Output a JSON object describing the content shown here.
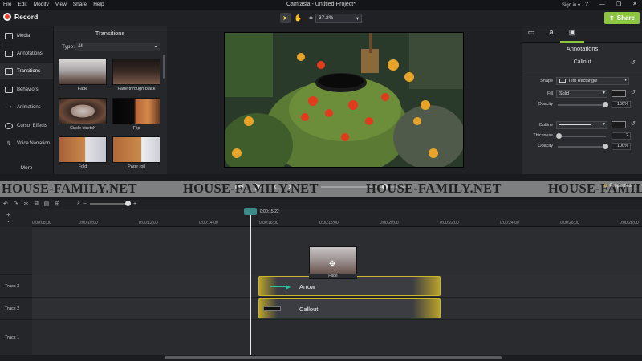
{
  "app": {
    "menu": [
      "File",
      "Edit",
      "Modify",
      "View",
      "Share",
      "Help"
    ],
    "title": "Camtasia - Untitled Project*",
    "sign_in": "Sign in ▾",
    "window_controls": [
      "?",
      "—",
      "❐",
      "✕"
    ]
  },
  "toolbar": {
    "record_label": "Record",
    "zoom_value": "37.2%",
    "share_label": "Share"
  },
  "nav": {
    "items": [
      {
        "label": "Media",
        "icon": "media-icon"
      },
      {
        "label": "Annotations",
        "icon": "annotations-icon"
      },
      {
        "label": "Transitions",
        "icon": "transitions-icon"
      },
      {
        "label": "Behaviors",
        "icon": "behaviors-icon"
      },
      {
        "label": "Animations",
        "icon": "animations-icon"
      },
      {
        "label": "Cursor Effects",
        "icon": "cursor-icon"
      },
      {
        "label": "Voice Narration",
        "icon": "mic-icon"
      }
    ],
    "more": "More"
  },
  "transitions": {
    "title": "Transitions",
    "type_label": "Type:",
    "type_value": "All",
    "items": [
      "Fade",
      "Fade through black",
      "Circle stretch",
      "Flip",
      "Fold",
      "Page roll"
    ]
  },
  "props": {
    "title": "Annotations",
    "callout": "Callout",
    "shape_label": "Shape",
    "shape_value": "Text Rectangle",
    "fill_label": "Fill",
    "fill_value": "Solid",
    "opacity_label": "Opacity",
    "opacity_value": "100%",
    "outline_label": "Outline",
    "thickness_label": "Thickness",
    "thickness_value": "2",
    "opacity2_label": "Opacity",
    "opacity2_value": "100%"
  },
  "watermark": [
    "HOUSE-FAMILY.NET",
    "HOUSE-FAMILY.NET",
    "HOUSE-FAMILY.NET",
    "HOUSE-FAMILY.NET"
  ],
  "playback": {
    "properties_label": "Properties"
  },
  "timeline": {
    "playhead_time": "0:00:15;22",
    "ticks": [
      "0:00:08;00",
      "0:00:10;00",
      "0:00:12;00",
      "0:00:14;00",
      "0:00:16;00",
      "0:00:18;00",
      "0:00:20;00",
      "0:00:22;00",
      "0:00:24;00",
      "0:00:26;00",
      "0:00:28;00"
    ],
    "tracks": [
      {
        "name": "Track 3",
        "clip": "Arrow"
      },
      {
        "name": "Track 2",
        "clip": "Callout"
      },
      {
        "name": "Track 1",
        "clip": ""
      }
    ],
    "transition_clip_label": "Fade"
  },
  "colors": {
    "accent_green": "#8dc63f",
    "record_red": "#e8412c",
    "clip_yellow": "#c9b62a"
  }
}
